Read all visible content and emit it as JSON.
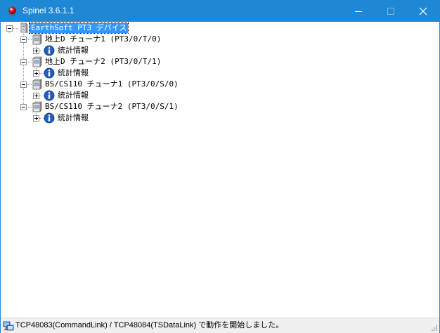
{
  "window": {
    "title": "Spinel 3.6.1.1"
  },
  "tree": {
    "root_label": "EarthSoft PT3 デバイス",
    "tuners": [
      {
        "label": "地上D チューナ1 (PT3/0/T/0)",
        "child_label": "統計情報"
      },
      {
        "label": "地上D チューナ2 (PT3/0/T/1)",
        "child_label": "統計情報"
      },
      {
        "label": "BS/CS110 チューナ1 (PT3/0/S/0)",
        "child_label": "統計情報"
      },
      {
        "label": "BS/CS110 チューナ2 (PT3/0/S/1)",
        "child_label": "統計情報"
      }
    ]
  },
  "statusbar": {
    "text": "TCP48083(CommandLink) / TCP48084(TSDataLink) で動作を開始しました。"
  },
  "colors": {
    "titlebar": "#1e88d6",
    "selection": "#3399ff",
    "info_icon": "#1f5fbf"
  },
  "icons": {
    "app": "spinel-app-icon",
    "root": "pc-device-icon",
    "tuner": "tuner-device-icon",
    "info": "info-icon",
    "status": "network-link-icon"
  }
}
